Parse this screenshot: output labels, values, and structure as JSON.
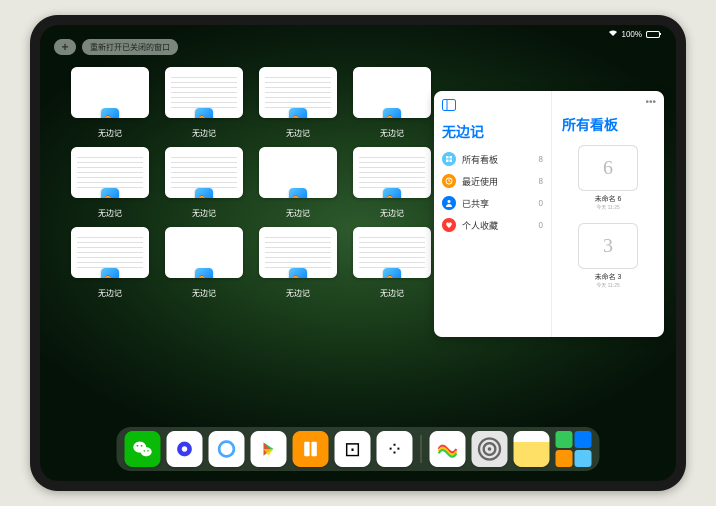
{
  "status": {
    "battery_text": "100%"
  },
  "top": {
    "add_label": "+",
    "reopen_label": "重新打开已关闭的窗口"
  },
  "app_name": "无边记",
  "windows": [
    {
      "label": "无边记",
      "content": false
    },
    {
      "label": "无边记",
      "content": true
    },
    {
      "label": "无边记",
      "content": true
    },
    {
      "label": "无边记",
      "content": false
    },
    {
      "label": "无边记",
      "content": true
    },
    {
      "label": "无边记",
      "content": true
    },
    {
      "label": "无边记",
      "content": false
    },
    {
      "label": "无边记",
      "content": true
    },
    {
      "label": "无边记",
      "content": true
    },
    {
      "label": "无边记",
      "content": false
    },
    {
      "label": "无边记",
      "content": true
    },
    {
      "label": "无边记",
      "content": true
    }
  ],
  "panel": {
    "left_title": "无边记",
    "right_title": "所有看板",
    "categories": [
      {
        "name": "所有看板",
        "count": 8,
        "color": "#5ac8fa",
        "icon": "grid"
      },
      {
        "name": "最近使用",
        "count": 8,
        "color": "#ff9500",
        "icon": "clock"
      },
      {
        "name": "已共享",
        "count": 0,
        "color": "#007aff",
        "icon": "person"
      },
      {
        "name": "个人收藏",
        "count": 0,
        "color": "#ff3b30",
        "icon": "heart"
      }
    ],
    "boards": [
      {
        "scribble": "6",
        "name": "未命名 6",
        "sub": "今天 11:25"
      },
      {
        "scribble": "3",
        "name": "未命名 3",
        "sub": "今天 11:25"
      }
    ]
  },
  "dock": {
    "apps": [
      {
        "name": "wechat",
        "bg": "#09bb07",
        "emoji": "✳"
      },
      {
        "name": "quark-hd",
        "bg": "#ffffff",
        "emoji": "●"
      },
      {
        "name": "quark",
        "bg": "#ffffff",
        "emoji": "◯"
      },
      {
        "name": "play",
        "bg": "#ffffff",
        "emoji": "▶"
      },
      {
        "name": "books",
        "bg": "#ff9500",
        "emoji": "▮▮"
      },
      {
        "name": "dice",
        "bg": "#ffffff",
        "emoji": "⊡"
      },
      {
        "name": "connect",
        "bg": "#ffffff",
        "emoji": "⁘"
      }
    ],
    "recent": [
      {
        "name": "freeform",
        "bg": "#ffffff",
        "emoji": "〰"
      },
      {
        "name": "settings",
        "bg": "#e5e5e5",
        "emoji": "⚙"
      },
      {
        "name": "notes",
        "bg": "#ffe066",
        "emoji": ""
      }
    ]
  }
}
